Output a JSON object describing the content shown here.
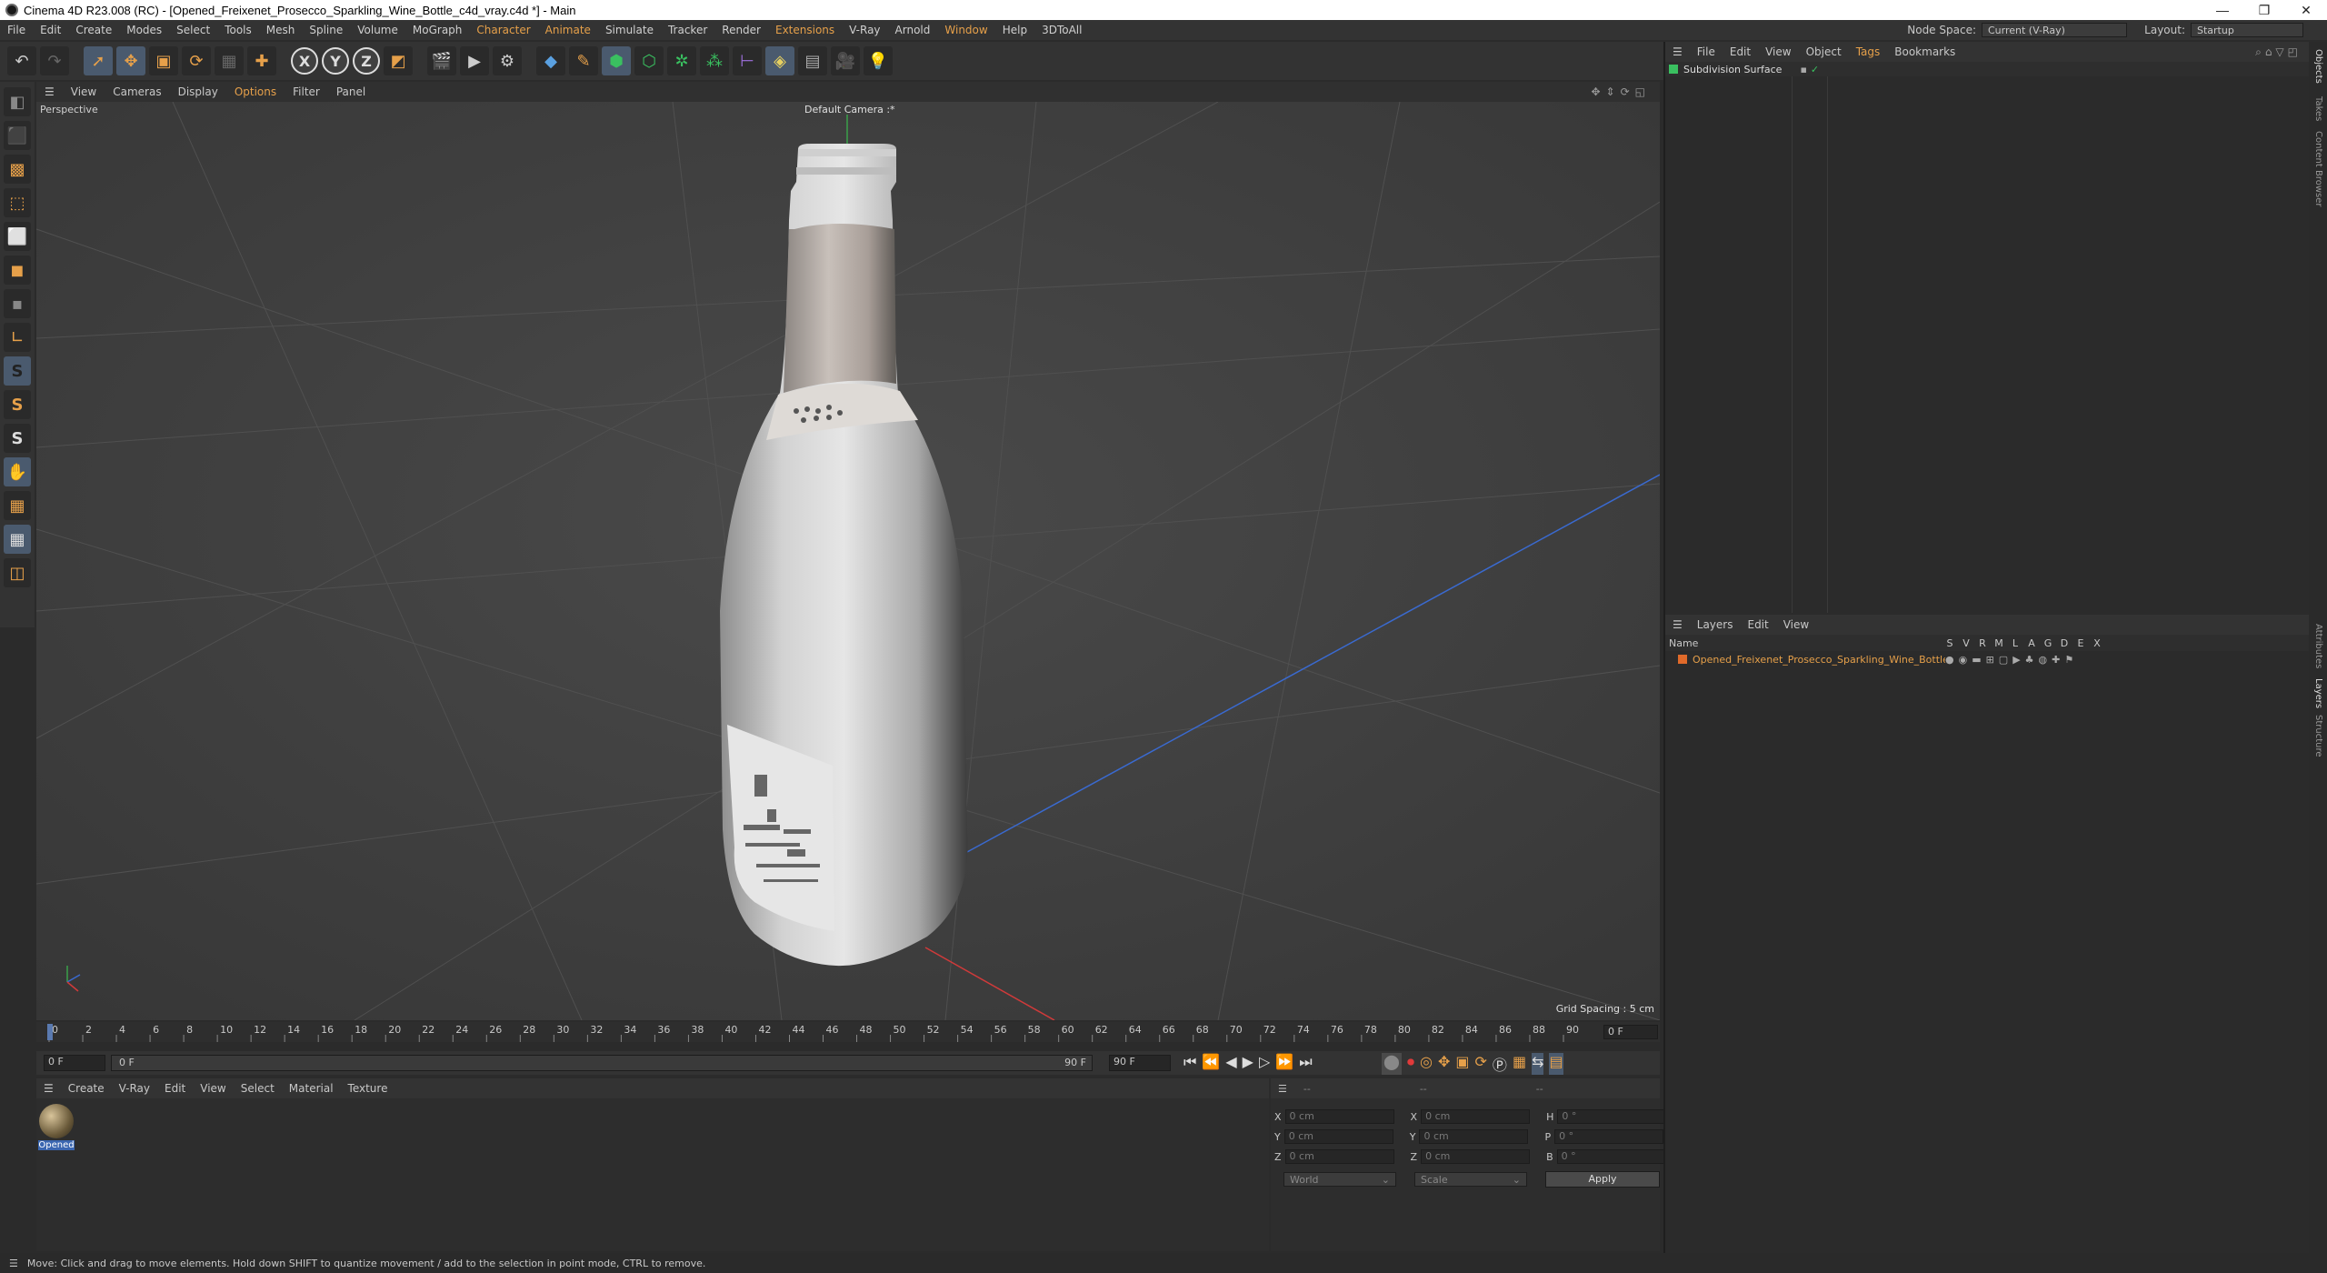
{
  "window": {
    "title": "Cinema 4D R23.008 (RC) - [Opened_Freixenet_Prosecco_Sparkling_Wine_Bottle_c4d_vray.c4d *] - Main",
    "controls": [
      "—",
      "❐",
      "✕"
    ]
  },
  "menubar": {
    "items": [
      "File",
      "Edit",
      "Create",
      "Modes",
      "Select",
      "Tools",
      "Mesh",
      "Spline",
      "Volume",
      "MoGraph",
      "Character",
      "Animate",
      "Simulate",
      "Tracker",
      "Render",
      "Extensions",
      "V-Ray",
      "Arnold",
      "Window",
      "Help",
      "3DToAll"
    ],
    "node_space_label": "Node Space:",
    "node_space_value": "Current (V-Ray)",
    "layout_label": "Layout:",
    "layout_value": "Startup"
  },
  "viewport": {
    "menu": [
      "View",
      "Cameras",
      "Display",
      "Options",
      "Filter",
      "Panel"
    ],
    "view_name": "Perspective",
    "camera": "Default Camera :*",
    "grid_spacing": "Grid Spacing : 5 cm"
  },
  "timeline": {
    "ticks": [
      "0",
      "2",
      "4",
      "6",
      "8",
      "10",
      "12",
      "14",
      "16",
      "18",
      "20",
      "22",
      "24",
      "26",
      "28",
      "30",
      "32",
      "34",
      "36",
      "38",
      "40",
      "42",
      "44",
      "46",
      "48",
      "50",
      "52",
      "54",
      "56",
      "58",
      "60",
      "62",
      "64",
      "66",
      "68",
      "70",
      "72",
      "74",
      "76",
      "78",
      "80",
      "82",
      "84",
      "86",
      "88",
      "90"
    ],
    "current_frame": "0 F",
    "start_field": "0 F",
    "range_start": "0 F",
    "range_end": "90 F",
    "end_field": "90 F"
  },
  "material_manager": {
    "menu": [
      "Create",
      "V-Ray",
      "Edit",
      "View",
      "Select",
      "Material",
      "Texture"
    ],
    "materials": [
      {
        "name": "Opened"
      }
    ]
  },
  "coordinates": {
    "rows": [
      {
        "a": "X",
        "av": "0 cm",
        "b": "X",
        "bv": "0 cm",
        "c": "H",
        "cv": "0 °"
      },
      {
        "a": "Y",
        "av": "0 cm",
        "b": "Y",
        "bv": "0 cm",
        "c": "P",
        "cv": "0 °"
      },
      {
        "a": "Z",
        "av": "0 cm",
        "b": "Z",
        "bv": "0 cm",
        "c": "B",
        "cv": "0 °"
      }
    ],
    "mode1": "World",
    "mode2": "Scale",
    "apply": "Apply",
    "header_left": "--",
    "header_mid": "--",
    "header_right": "--"
  },
  "objects_panel": {
    "menu": [
      "File",
      "Edit",
      "View",
      "Object",
      "Tags",
      "Bookmarks"
    ],
    "items": [
      {
        "name": "Subdivision Surface"
      }
    ]
  },
  "layers_panel": {
    "menu": [
      "Layers",
      "Edit",
      "View"
    ],
    "columns": [
      "Name",
      "S",
      "V",
      "R",
      "M",
      "L",
      "A",
      "G",
      "D",
      "E",
      "X"
    ],
    "items": [
      {
        "name": "Opened_Freixenet_Prosecco_Sparkling_Wine_Bottle",
        "color": "#e06a2a"
      }
    ]
  },
  "side_tabs": [
    "Objects",
    "Takes",
    "Content Browser",
    "Attributes",
    "Layers",
    "Structure"
  ],
  "status": "Move: Click and drag to move elements. Hold down SHIFT to quantize movement / add to the selection in point mode, CTRL to remove.",
  "colors": {
    "accent": "#e6a04a",
    "layer_text": "#e6a04a",
    "axis_x": "#d03a3a",
    "axis_y": "#3aa04a",
    "axis_z": "#3a6ad0"
  }
}
